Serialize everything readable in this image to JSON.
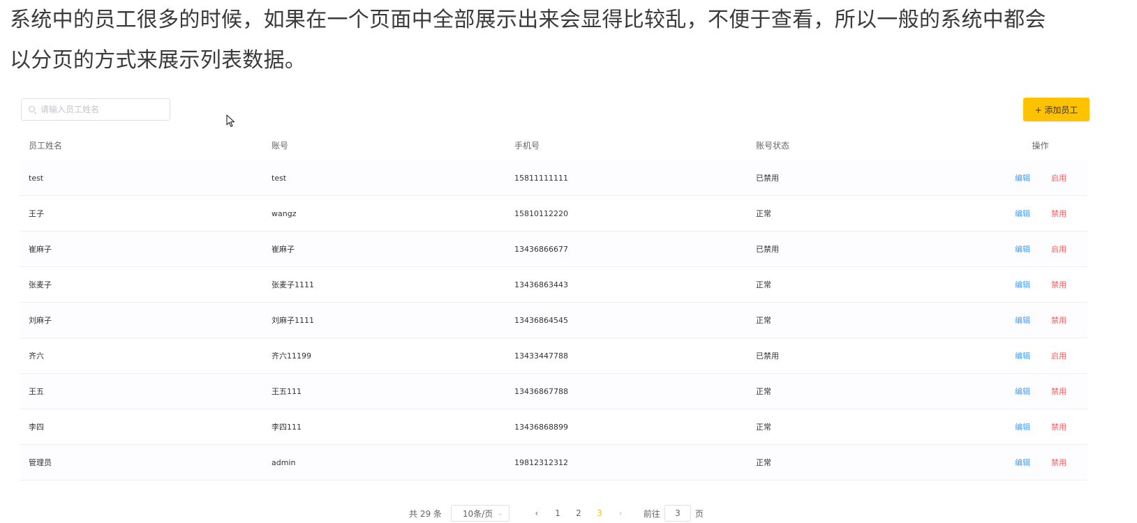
{
  "intro": {
    "line1": "系统中的员工很多的时候，如果在一个页面中全部展示出来会显得比较乱，不便于查看，所以一般的系统中都会",
    "line2": "以分页的方式来展示列表数据。"
  },
  "toolbar": {
    "search_placeholder": "请输入员工姓名",
    "search_icon": "search-icon",
    "add_label": "+ 添加员工",
    "add_color": "#ffc200"
  },
  "table": {
    "headers": [
      "员工姓名",
      "账号",
      "手机号",
      "账号状态",
      "操作"
    ],
    "rows": [
      {
        "name": "test",
        "account": "test",
        "phone": "15811111111",
        "status": "已禁用",
        "edit": "编辑",
        "toggle": "启用"
      },
      {
        "name": "王子",
        "account": "wangz",
        "phone": "15810112220",
        "status": "正常",
        "edit": "编辑",
        "toggle": "禁用"
      },
      {
        "name": "崔麻子",
        "account": "崔麻子",
        "phone": "13436866677",
        "status": "已禁用",
        "edit": "编辑",
        "toggle": "启用"
      },
      {
        "name": "张麦子",
        "account": "张麦子1111",
        "phone": "13436863443",
        "status": "正常",
        "edit": "编辑",
        "toggle": "禁用"
      },
      {
        "name": "刘麻子",
        "account": "刘麻子1111",
        "phone": "13436864545",
        "status": "正常",
        "edit": "编辑",
        "toggle": "禁用"
      },
      {
        "name": "齐六",
        "account": "齐六11199",
        "phone": "13433447788",
        "status": "已禁用",
        "edit": "编辑",
        "toggle": "启用"
      },
      {
        "name": "王五",
        "account": "王五111",
        "phone": "13436867788",
        "status": "正常",
        "edit": "编辑",
        "toggle": "禁用"
      },
      {
        "name": "李四",
        "account": "李四111",
        "phone": "13436868899",
        "status": "正常",
        "edit": "编辑",
        "toggle": "禁用"
      },
      {
        "name": "管理员",
        "account": "admin",
        "phone": "19812312312",
        "status": "正常",
        "edit": "编辑",
        "toggle": "禁用"
      }
    ],
    "edit_color": "#419eff",
    "toggle_color": "#ff5a5a"
  },
  "pagination": {
    "total_label": "共 29 条",
    "page_size": "10条/页",
    "pages": [
      "1",
      "2",
      "3"
    ],
    "current_page": "3",
    "goto_prefix": "前往",
    "goto_value": "3",
    "goto_suffix": "页",
    "active_color": "#ffc200"
  }
}
